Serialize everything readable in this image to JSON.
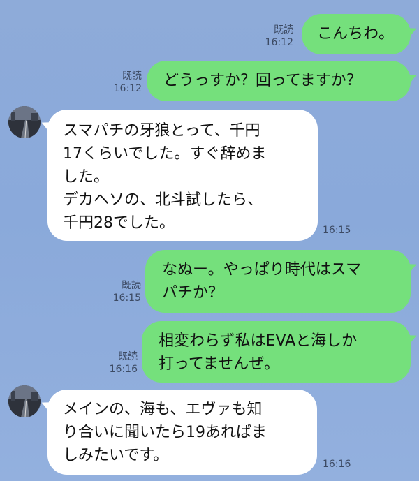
{
  "messages": [
    {
      "side": "out",
      "text": "こんちわ。",
      "read": "既読",
      "time": "16:12"
    },
    {
      "side": "out",
      "text": "どうっすか？回ってますか？",
      "read": "既読",
      "time": "16:12"
    },
    {
      "side": "in",
      "text": "スマパチの牙狼とって、千円\n17くらいでした。すぐ辞めま\nした。\nデカヘソの、北斗試したら、\n千円28でした。",
      "time": "16:15"
    },
    {
      "side": "out",
      "text": "なぬー。やっぱり時代はスマ\nパチか？",
      "read": "既読",
      "time": "16:15"
    },
    {
      "side": "out",
      "text": "相変わらず私はEVAと海しか\n打ってませんぜ。",
      "read": "既読",
      "time": "16:16"
    },
    {
      "side": "in",
      "text": "メインの、海も、エヴァも知\nり合いに聞いたら19あればま\nしみたいです。",
      "time": "16:16"
    }
  ],
  "colors": {
    "outgoing_bubble": "#75e07c",
    "incoming_bubble": "#ffffff",
    "background": "#8eabd9",
    "meta_text": "#3c4a63"
  },
  "icons": {
    "avatar": "contact-avatar-road-photo"
  }
}
